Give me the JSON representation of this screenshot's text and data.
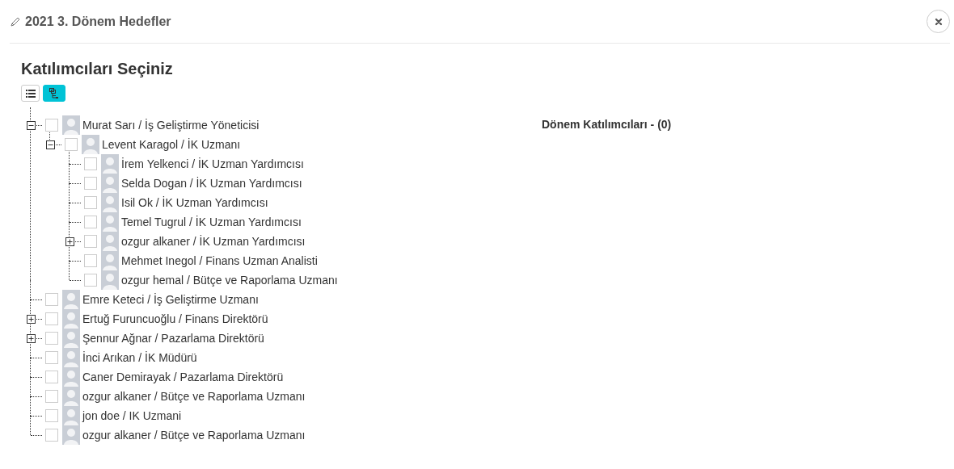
{
  "dialog": {
    "title": "2021 3. Dönem Hedefler"
  },
  "heading": "Katılımcıları Seçiniz",
  "view_buttons": [
    {
      "kind": "list",
      "selected": false
    },
    {
      "kind": "tree",
      "selected": true
    }
  ],
  "tree": [
    {
      "label": "Murat Sarı / İş Geliştirme Yöneticisi",
      "checked": false,
      "expanded": true,
      "children": [
        {
          "label": "Levent Karagol / İK Uzmanı",
          "checked": false,
          "expanded": true,
          "children": [
            {
              "label": "İrem Yelkenci / İK Uzman Yardımcısı",
              "checked": false
            },
            {
              "label": "Selda Dogan / İK Uzman Yardımcısı",
              "checked": false
            },
            {
              "label": "Isil Ok / İK Uzman Yardımcısı",
              "checked": false
            },
            {
              "label": "Temel Tugrul / İK Uzman Yardımcısı",
              "checked": false
            },
            {
              "label": "ozgur alkaner / İK Uzman Yardımcısı",
              "checked": false,
              "expanded": false
            },
            {
              "label": "Mehmet Inegol / Finans Uzman Analisti",
              "checked": false
            },
            {
              "label": "ozgur hemal / Bütçe ve Raporlama Uzmanı",
              "checked": false
            }
          ]
        }
      ]
    },
    {
      "label": "Emre Keteci / İş Geliştirme Uzmanı",
      "checked": false
    },
    {
      "label": "Ertuğ Furuncuoğlu / Finans Direktörü",
      "checked": false,
      "expanded": false
    },
    {
      "label": "Şennur Ağnar / Pazarlama Direktörü",
      "checked": false,
      "expanded": false
    },
    {
      "label": "İnci Arıkan / İK Müdürü",
      "checked": false
    },
    {
      "label": "Caner Demirayak / Pazarlama Direktörü",
      "checked": false
    },
    {
      "label": "ozgur alkaner / Bütçe ve Raporlama Uzmanı",
      "checked": false
    },
    {
      "label": "jon doe / IK Uzmani",
      "checked": false
    },
    {
      "label": "ozgur alkaner / Bütçe ve Raporlama Uzmanı",
      "checked": false
    }
  ],
  "selected_panel": {
    "title": "Dönem Katılımcıları - (0)"
  }
}
